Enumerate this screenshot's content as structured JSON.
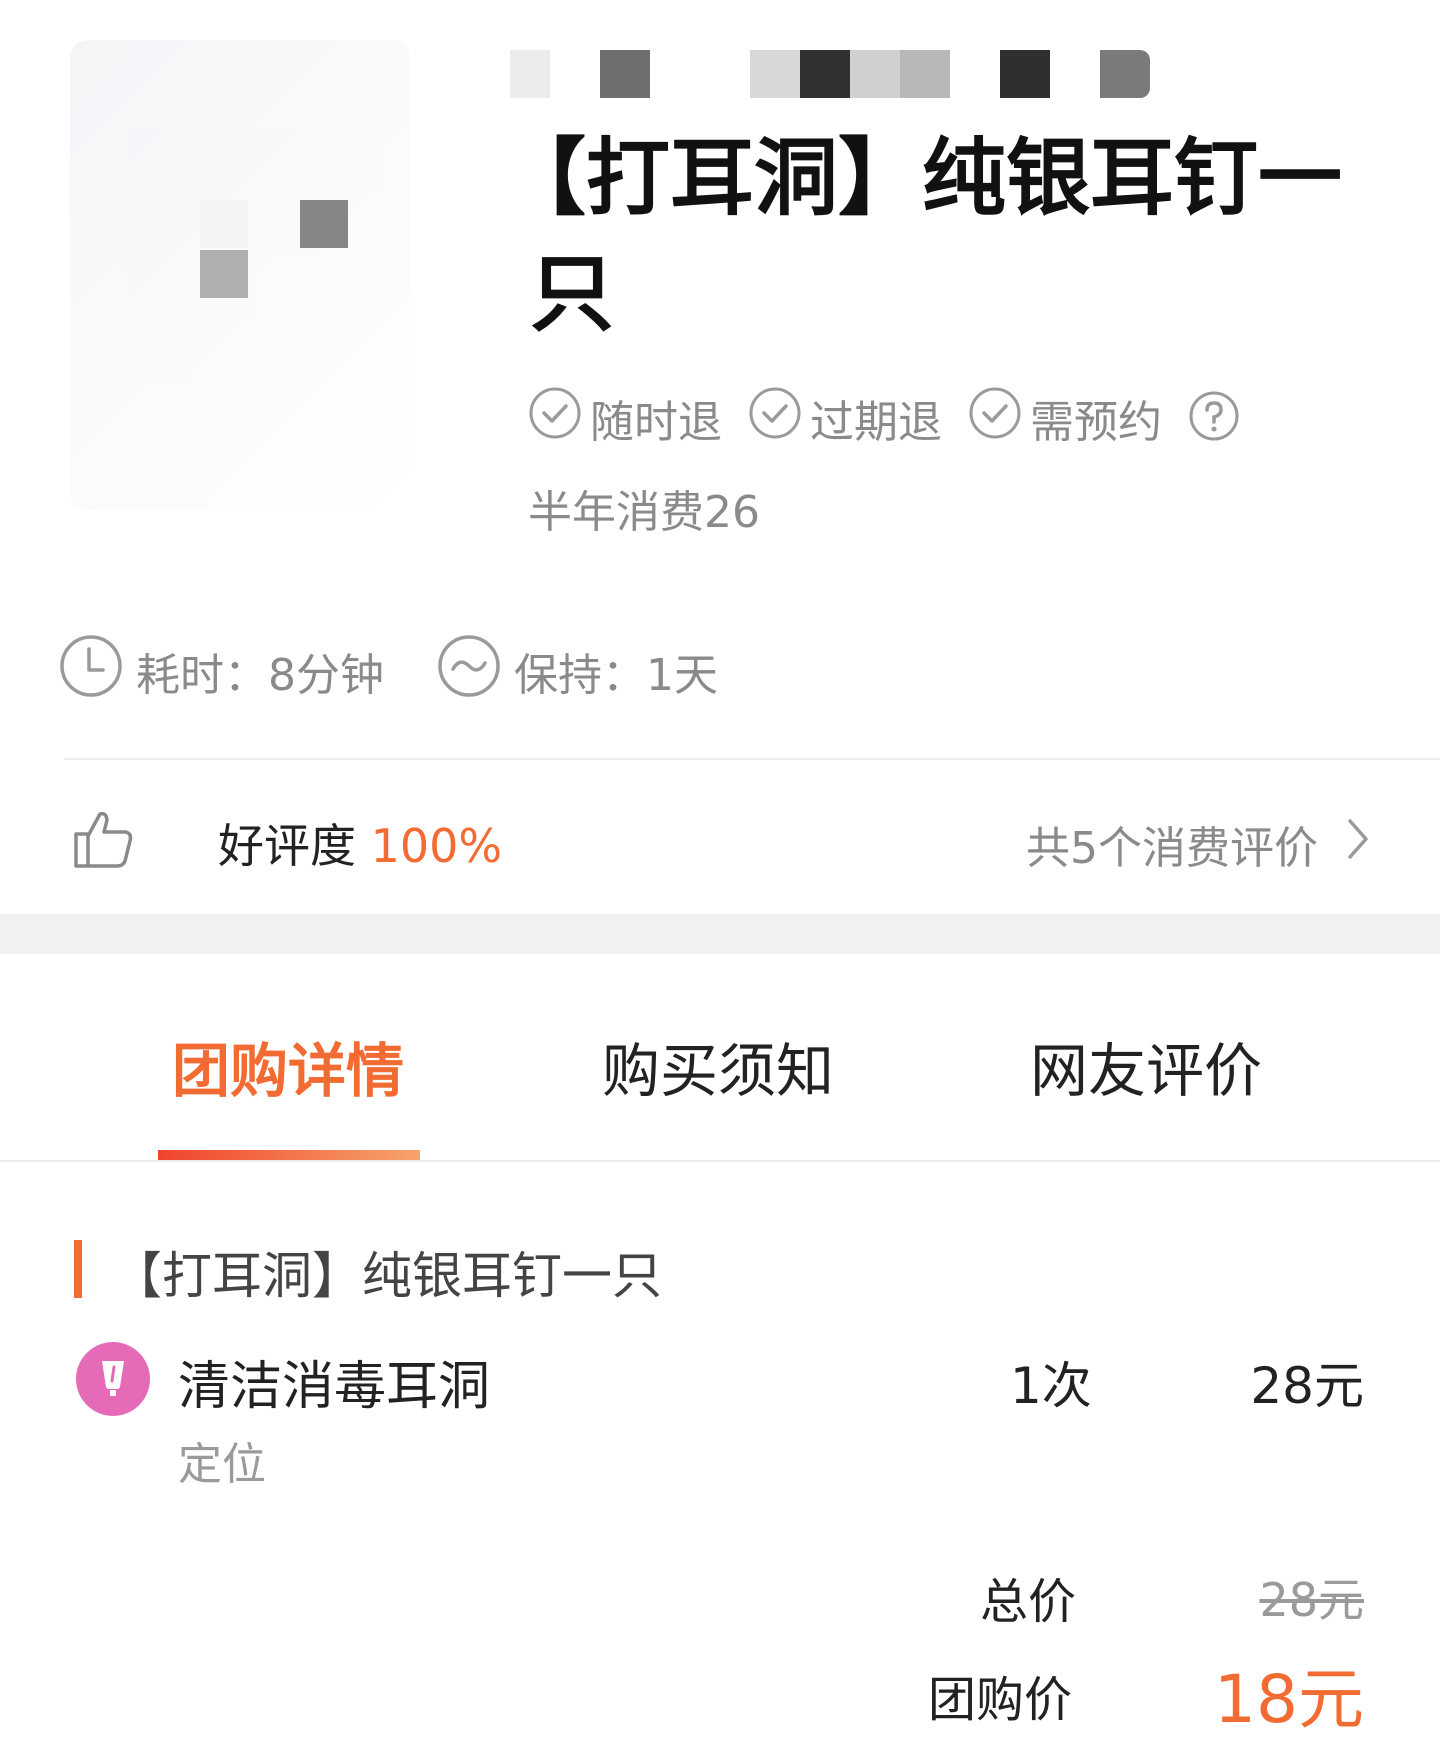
{
  "product": {
    "title_line1": "【打耳洞】纯银耳钉一",
    "title_line2": "只",
    "tags": [
      {
        "label": "随时退",
        "icon": "check-circle-icon"
      },
      {
        "label": "过期退",
        "icon": "check-circle-icon"
      },
      {
        "label": "需预约",
        "icon": "check-circle-icon"
      }
    ],
    "help_icon": "question-circle-icon",
    "sold": "半年消费26"
  },
  "meta": {
    "duration": "耗时：8分钟",
    "keep": "保持：1天"
  },
  "rating": {
    "label": "好评度 ",
    "value": "100%",
    "reviews_link": "共5个消费评价"
  },
  "tabs": [
    {
      "label": "团购详情",
      "active": true
    },
    {
      "label": "购买须知",
      "active": false
    },
    {
      "label": "网友评价",
      "active": false
    }
  ],
  "package": {
    "title": "【打耳洞】纯银耳钉一只",
    "item": {
      "name": "清洁消毒耳洞",
      "sub": "定位",
      "count": "1次",
      "price": "28元"
    },
    "total_label": "总价",
    "total_value": "28元",
    "group_label": "团购价",
    "group_value": "18元"
  },
  "colors": {
    "accent": "#f26b33",
    "muted": "#8a8a8a",
    "item_icon_bg": "#e56bb8"
  }
}
